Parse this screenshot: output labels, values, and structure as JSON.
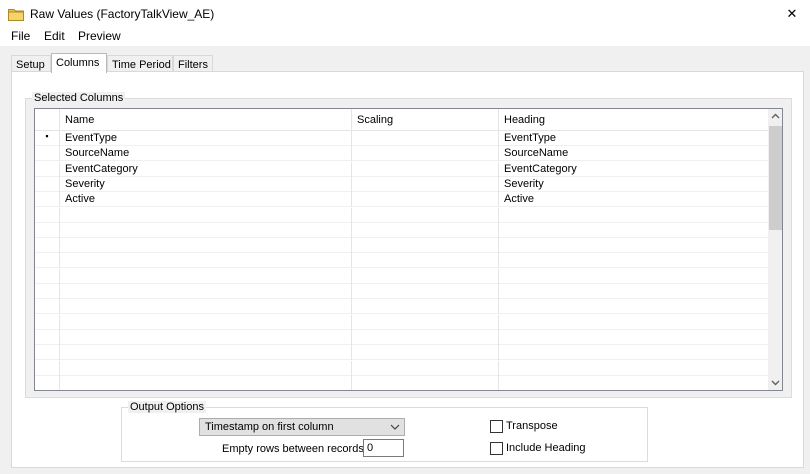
{
  "window": {
    "title": "Raw Values (FactoryTalkView_AE)",
    "icon": "folder-icon",
    "close_glyph": "✕"
  },
  "menu": [
    {
      "label": "File"
    },
    {
      "label": "Edit"
    },
    {
      "label": "Preview"
    }
  ],
  "tabs": [
    {
      "label": "Setup",
      "active": false
    },
    {
      "label": "Columns",
      "active": true
    },
    {
      "label": "Time Period",
      "active": false
    },
    {
      "label": "Filters",
      "active": false
    }
  ],
  "selected_columns": {
    "legend": "Selected Columns",
    "headers": [
      "Name",
      "Scaling",
      "Heading"
    ],
    "current_row_marker": "▪",
    "rows": [
      {
        "name": "EventType",
        "scaling": "",
        "heading": "EventType"
      },
      {
        "name": "SourceName",
        "scaling": "",
        "heading": "SourceName"
      },
      {
        "name": "EventCategory",
        "scaling": "",
        "heading": "EventCategory"
      },
      {
        "name": "Severity",
        "scaling": "",
        "heading": "Severity"
      },
      {
        "name": "Active",
        "scaling": "",
        "heading": "Active"
      },
      {
        "name": "",
        "scaling": "",
        "heading": ""
      },
      {
        "name": "",
        "scaling": "",
        "heading": ""
      },
      {
        "name": "",
        "scaling": "",
        "heading": ""
      },
      {
        "name": "",
        "scaling": "",
        "heading": ""
      },
      {
        "name": "",
        "scaling": "",
        "heading": ""
      },
      {
        "name": "",
        "scaling": "",
        "heading": ""
      },
      {
        "name": "",
        "scaling": "",
        "heading": ""
      },
      {
        "name": "",
        "scaling": "",
        "heading": ""
      },
      {
        "name": "",
        "scaling": "",
        "heading": ""
      },
      {
        "name": "",
        "scaling": "",
        "heading": ""
      },
      {
        "name": "",
        "scaling": "",
        "heading": ""
      },
      {
        "name": "",
        "scaling": "",
        "heading": ""
      }
    ]
  },
  "output_options": {
    "legend": "Output Options",
    "timestamp_select": {
      "value": "Timestamp on first column"
    },
    "empty_rows_label": "Empty rows between records",
    "empty_rows_value": "0",
    "transpose_label": "Transpose",
    "transpose_checked": false,
    "include_heading_label": "Include Heading",
    "include_heading_checked": false
  }
}
